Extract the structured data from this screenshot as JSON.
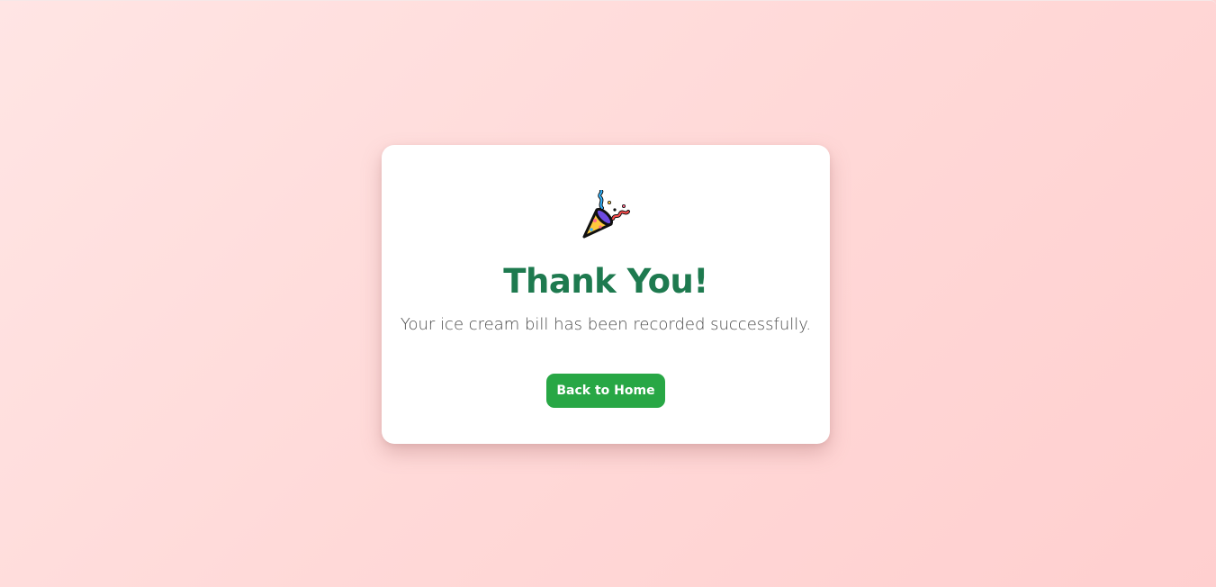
{
  "page": {
    "background_colors": [
      "#ffe5e4",
      "#ffcfcf"
    ]
  },
  "card": {
    "icon": "party-popper-icon",
    "title": "Thank You!",
    "message": "Your ice cream bill has been recorded successfully.",
    "button_label": "Back to Home",
    "colors": {
      "title": "#1e7a4f",
      "button": "#28a745",
      "button_text": "#ffffff"
    }
  }
}
